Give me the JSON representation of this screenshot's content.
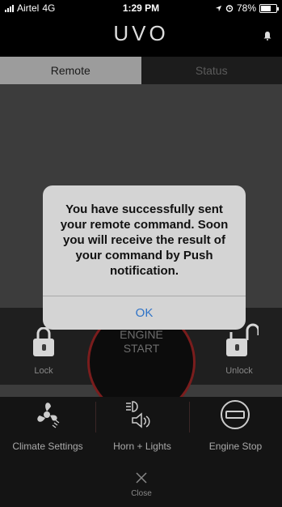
{
  "status_bar": {
    "carrier": "Airtel",
    "network": "4G",
    "time": "1:29 PM",
    "battery": "78%",
    "battery_level": 0.78,
    "icons": [
      "signal-icon",
      "location-arrow-icon",
      "alarm-icon",
      "battery-icon"
    ]
  },
  "header": {
    "logo": "UVO",
    "bell_icon": "bell-icon"
  },
  "tabs": [
    {
      "label": "Remote",
      "active": true
    },
    {
      "label": "Status",
      "active": false
    }
  ],
  "remote": {
    "lock_label": "Lock",
    "unlock_label": "Unlock",
    "engine_line1": "ENGINE",
    "engine_line2": "START"
  },
  "actions": [
    {
      "label": "Climate Settings",
      "icon": "fan-icon"
    },
    {
      "label": "Horn + Lights",
      "icon": "horn-lights-icon"
    },
    {
      "label": "Engine Stop",
      "icon": "engine-stop-icon"
    }
  ],
  "close": {
    "label": "Close",
    "icon": "close-icon"
  },
  "dialog": {
    "message": "You have successfully sent your remote command. Soon you will receive the result of your command by Push notification.",
    "ok_label": "OK"
  },
  "colors": {
    "tab_active": "#9c9c9c",
    "content_bg": "#3c3c3c",
    "accent_red": "#7a1d1d",
    "dialog_bg": "#d4d4d4",
    "ok_blue": "#2f73c7"
  }
}
